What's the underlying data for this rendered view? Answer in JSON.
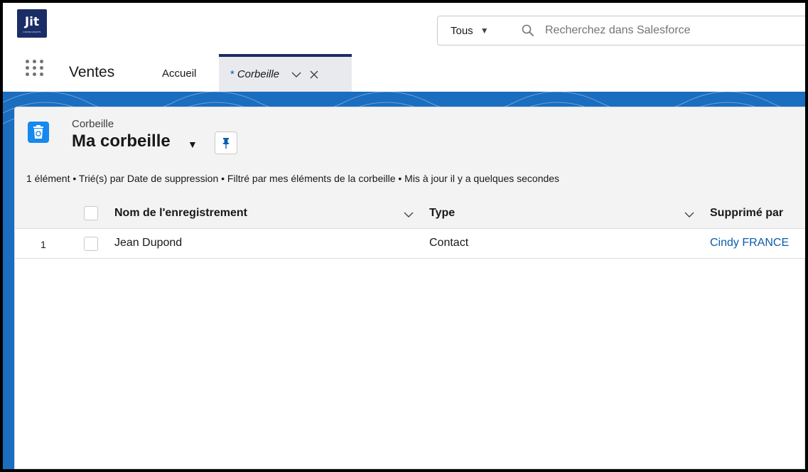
{
  "header": {
    "logo_text": "Jit",
    "logo_sub": "CONSULTANTS",
    "scope_label": "Tous",
    "search_placeholder": "Recherchez dans Salesforce"
  },
  "nav": {
    "app_name": "Ventes",
    "tabs": [
      {
        "label": "Accueil"
      },
      {
        "label": "Corbeille",
        "modified_mark": "*"
      }
    ]
  },
  "list": {
    "object_type": "Corbeille",
    "title": "Ma corbeille",
    "meta": "1 élément • Trié(s) par Date de suppression • Filtré par mes éléments de la corbeille • Mis à jour il y a quelques secondes",
    "columns": [
      "Nom de l'enregistrement",
      "Type",
      "Supprimé par"
    ],
    "rows": [
      {
        "number": "1",
        "name": "Jean Dupond",
        "type": "Contact",
        "deleted_by": "Cindy FRANCE"
      }
    ]
  },
  "colors": {
    "brand": "#1b2d66",
    "band": "#1b6dbf",
    "link": "#0b5cab",
    "object_icon": "#1589ee"
  },
  "icons": [
    "search-icon",
    "app-launcher-icon",
    "chevron-down-icon",
    "close-icon",
    "recycle-bin-icon",
    "pin-icon",
    "caret-down-icon"
  ]
}
